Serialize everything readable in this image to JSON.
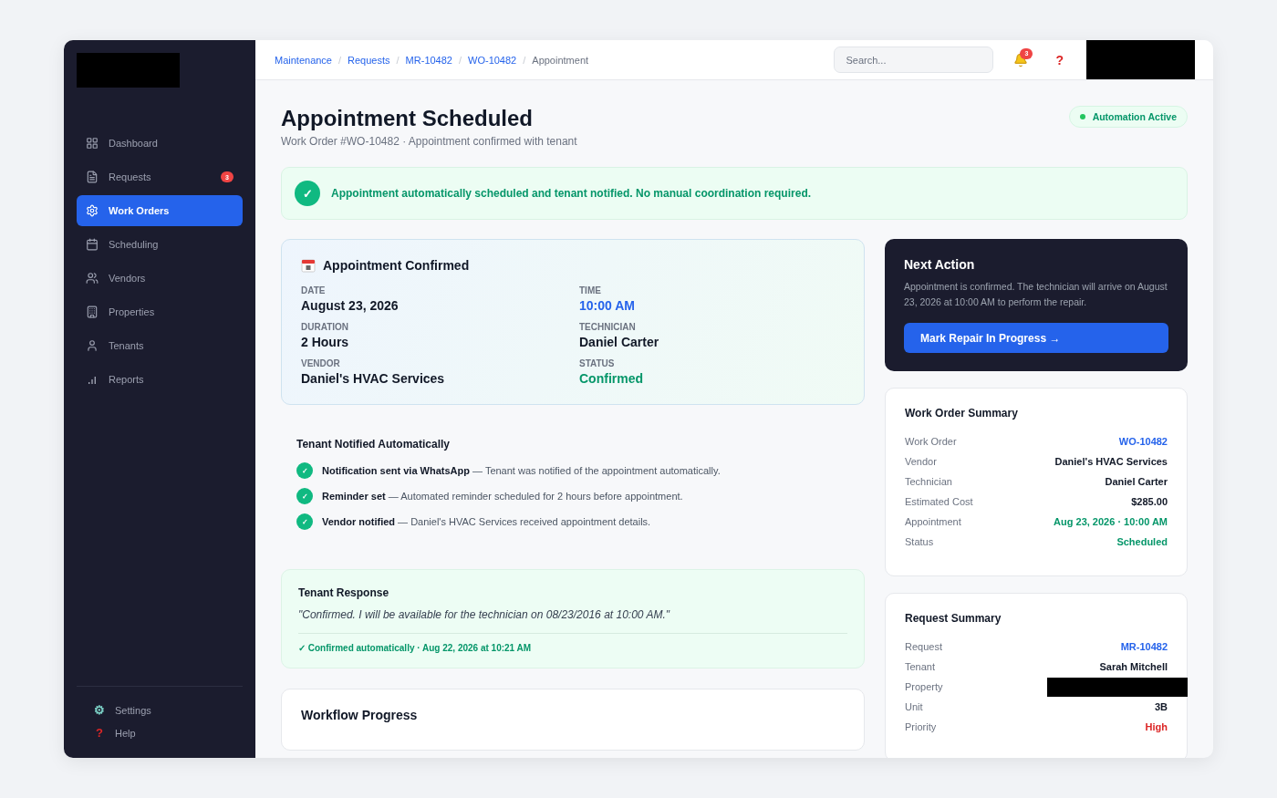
{
  "sidebar": {
    "logo": {
      "redacted": true
    },
    "items": [
      {
        "label": "Dashboard",
        "selected": false
      },
      {
        "label": "Requests",
        "selected": false,
        "badge": "3"
      },
      {
        "label": "Work Orders",
        "selected": true
      },
      {
        "label": "Scheduling",
        "selected": false
      },
      {
        "label": "Vendors",
        "selected": false
      },
      {
        "label": "Properties",
        "selected": false
      },
      {
        "label": "Tenants",
        "selected": false
      },
      {
        "label": "Reports",
        "selected": false
      }
    ],
    "footer_items": [
      {
        "label": "Settings",
        "icon": "⚙"
      },
      {
        "label": "Help",
        "icon": "?"
      }
    ]
  },
  "topbar": {
    "breadcrumbs": [
      {
        "label": "Maintenance",
        "link": true
      },
      {
        "label": "Requests",
        "link": true
      },
      {
        "label": "MR-10482",
        "link": true
      },
      {
        "label": "WO-10482",
        "link": true
      },
      {
        "label": "Appointment",
        "link": false
      }
    ],
    "separator": "/",
    "search": {
      "placeholder": "Search..."
    },
    "notifications": "3",
    "help": "?",
    "avatar": {
      "redacted": true
    }
  },
  "header": {
    "title": "Appointment Scheduled",
    "subtitle": "Work Order #WO-10482 · Appointment confirmed with tenant",
    "status_pill": "Automation Active"
  },
  "banner": {
    "icon": "✓",
    "text": "Appointment automatically scheduled and tenant notified. No manual coordination required."
  },
  "appointment": {
    "title": "Appointment Confirmed",
    "fields": [
      {
        "label": "DATE",
        "value": "August 23, 2026",
        "kind": "plain"
      },
      {
        "label": "TIME",
        "value": "10:00 AM",
        "kind": "link"
      },
      {
        "label": "DURATION",
        "value": "2 Hours",
        "kind": "plain"
      },
      {
        "label": "TECHNICIAN",
        "value": "Daniel Carter",
        "kind": "plain"
      },
      {
        "label": "VENDOR",
        "value": "Daniel's HVAC Services",
        "kind": "plain"
      },
      {
        "label": "STATUS",
        "value": "Confirmed",
        "kind": "success"
      }
    ]
  },
  "notifications": {
    "title": "Tenant Notified Automatically",
    "items": [
      {
        "text": "**Notification sent via WhatsApp** — Tenant was notified of the appointment automatically."
      },
      {
        "text": "**Reminder set** — Automated reminder scheduled for 2 hours before appointment."
      },
      {
        "text": "**Vendor notified** — Daniel's HVAC Services received appointment details."
      }
    ]
  },
  "tenant_response": {
    "title": "Tenant Response",
    "quote": "\"Confirmed. I will be available for the technician on 08/23/2016 at 10:00 AM.\"",
    "footer": "✓ Confirmed automatically · Aug 22, 2026 at 10:21 AM"
  },
  "workflow": {
    "title": "Workflow Progress"
  },
  "next_action": {
    "title": "Next Action",
    "text": "Appointment is confirmed. The technician will arrive on August 23, 2026 at 10:00 AM to perform the repair.",
    "button": "Mark Repair In Progress →"
  },
  "work_order_summary": {
    "title": "Work Order Summary",
    "rows": [
      {
        "label": "Work Order",
        "value": "WO-10482",
        "kind": "link"
      },
      {
        "label": "Vendor",
        "value": "Daniel's HVAC Services",
        "kind": "plain"
      },
      {
        "label": "Technician",
        "value": "Daniel Carter",
        "kind": "plain"
      },
      {
        "label": "Estimated Cost",
        "value": "$285.00",
        "kind": "plain"
      },
      {
        "label": "Appointment",
        "value": "Aug 23, 2026 · 10:00 AM",
        "kind": "success"
      },
      {
        "label": "Status",
        "value": "Scheduled",
        "kind": "success"
      }
    ]
  },
  "request_summary": {
    "title": "Request Summary",
    "rows": [
      {
        "label": "Request",
        "value": "MR-10482",
        "kind": "link"
      },
      {
        "label": "Tenant",
        "value": "Sarah Mitchell",
        "kind": "plain"
      },
      {
        "label": "Property",
        "kind": "redacted"
      },
      {
        "label": "Unit",
        "value": "3B",
        "kind": "plain"
      },
      {
        "label": "Priority",
        "value": "High",
        "kind": "danger"
      }
    ]
  }
}
